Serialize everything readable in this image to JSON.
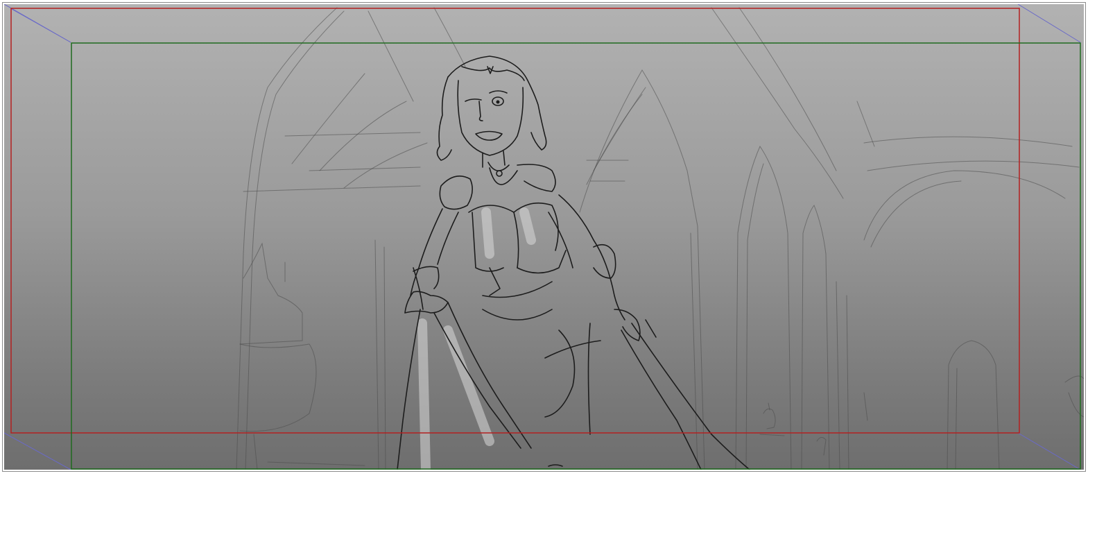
{
  "storyboard_panel": {
    "guides": {
      "camera_field_color": "#b32020",
      "safe_area_color": "#1f6b1f",
      "perspective_line_color": "#6a6ac8"
    },
    "background": {
      "gradient_top": "#b2b2b2",
      "gradient_bottom": "#6e6e6e"
    }
  }
}
